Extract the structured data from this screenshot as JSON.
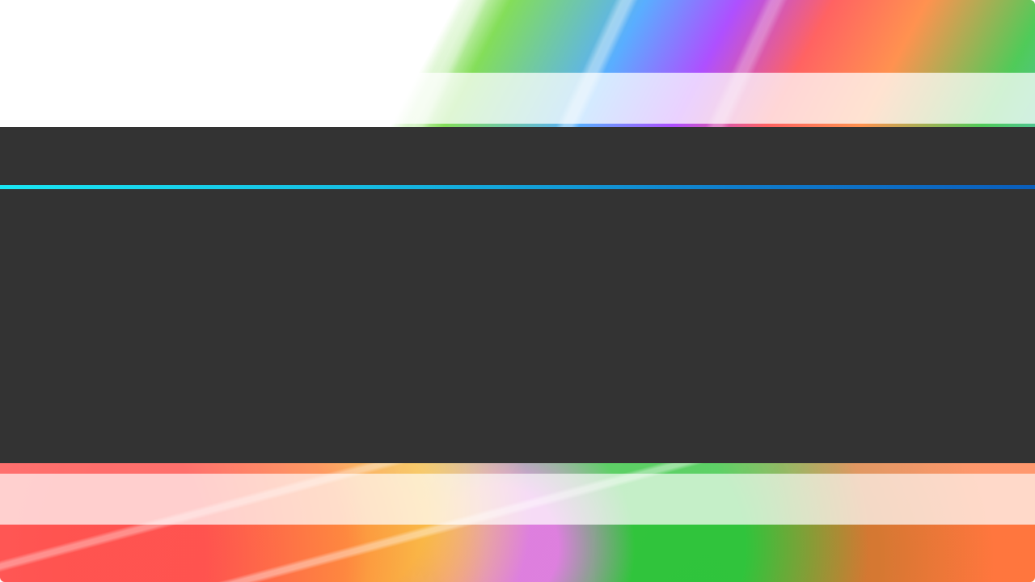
{
  "app": {
    "title": ""
  },
  "theme": {
    "panel_color": "#333333",
    "accent_start": "#19e7f4",
    "accent_end": "#0a5ebc"
  }
}
